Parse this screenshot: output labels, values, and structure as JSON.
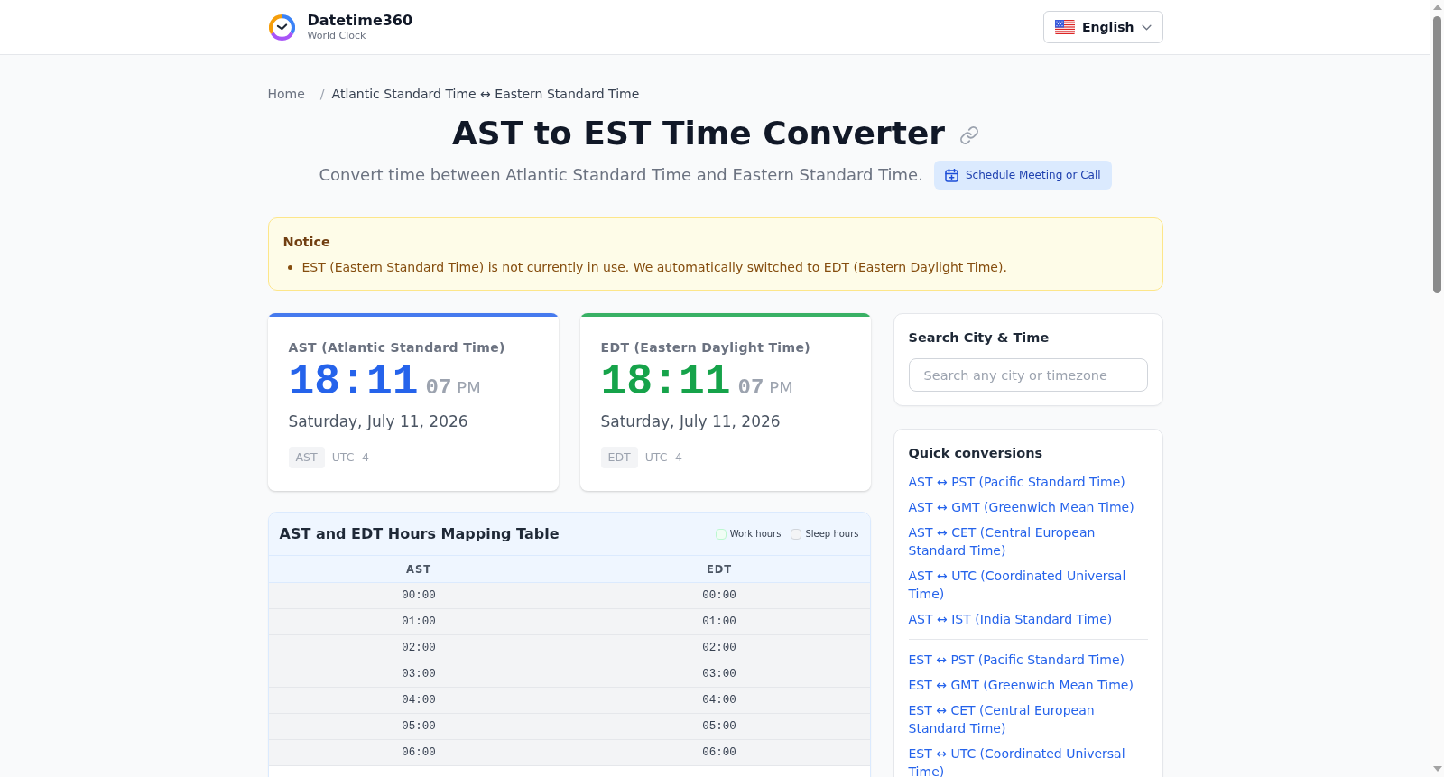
{
  "header": {
    "brand": "Datetime360",
    "tagline": "World Clock",
    "language": "English"
  },
  "breadcrumb": {
    "separator": "/",
    "items": [
      {
        "label": "Home",
        "current": false
      },
      {
        "label": "Atlantic Standard Time ↔ Eastern Standard Time",
        "current": true
      }
    ]
  },
  "title": "AST to EST Time Converter",
  "subtitle": "Convert time between Atlantic Standard Time and Eastern Standard Time.",
  "schedule_button": "Schedule Meeting or Call",
  "notice": {
    "title": "Notice",
    "items": [
      "EST (Eastern Standard Time) is not currently in use. We automatically switched to EDT (Eastern Daylight Time)."
    ]
  },
  "clocks": [
    {
      "zone_name": "AST (Atlantic Standard Time)",
      "time": "18:11",
      "seconds": "07",
      "period": "PM",
      "date": "Saturday, July 11, 2026",
      "abbr": "AST",
      "offset": "UTC -4",
      "color": "#2563eb"
    },
    {
      "zone_name": "EDT (Eastern Daylight Time)",
      "time": "18:11",
      "seconds": "07",
      "period": "PM",
      "date": "Saturday, July 11, 2026",
      "abbr": "EDT",
      "offset": "UTC -4",
      "color": "#16a34a"
    }
  ],
  "mapping_table": {
    "title": "AST and EDT Hours Mapping Table",
    "legend": [
      {
        "label": "Work hours",
        "kind": "work"
      },
      {
        "label": "Sleep hours",
        "kind": "sleep"
      }
    ],
    "columns": [
      "AST",
      "EDT"
    ],
    "rows": [
      {
        "cells": [
          "00:00",
          "00:00"
        ],
        "sleep": true
      },
      {
        "cells": [
          "01:00",
          "01:00"
        ],
        "sleep": true
      },
      {
        "cells": [
          "02:00",
          "02:00"
        ],
        "sleep": true
      },
      {
        "cells": [
          "03:00",
          "03:00"
        ],
        "sleep": true
      },
      {
        "cells": [
          "04:00",
          "04:00"
        ],
        "sleep": true
      },
      {
        "cells": [
          "05:00",
          "05:00"
        ],
        "sleep": true
      },
      {
        "cells": [
          "06:00",
          "06:00"
        ],
        "sleep": true
      },
      {
        "sleep": false
      }
    ]
  },
  "search": {
    "title": "Search City & Time",
    "placeholder": "Search any city or timezone"
  },
  "quick_conversions": {
    "title": "Quick conversions",
    "groups": [
      [
        "AST ↔ PST (Pacific Standard Time)",
        "AST ↔ GMT (Greenwich Mean Time)",
        "AST ↔ CET (Central European Standard Time)",
        "AST ↔ UTC (Coordinated Universal Time)",
        "AST ↔ IST (India Standard Time)"
      ],
      [
        "EST ↔ PST (Pacific Standard Time)",
        "EST ↔ GMT (Greenwich Mean Time)",
        "EST ↔ CET (Central European Standard Time)",
        "EST ↔ UTC (Coordinated Universal Time)"
      ]
    ]
  }
}
